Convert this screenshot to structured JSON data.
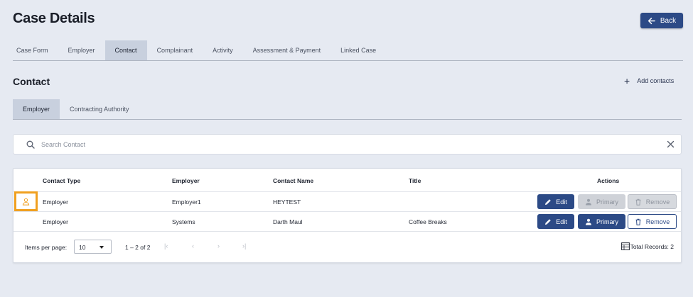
{
  "header": {
    "title": "Case Details",
    "back_label": "Back"
  },
  "main_tabs": [
    {
      "label": "Case Form",
      "active": false
    },
    {
      "label": "Employer",
      "active": false
    },
    {
      "label": "Contact",
      "active": true
    },
    {
      "label": "Complainant",
      "active": false
    },
    {
      "label": "Activity",
      "active": false
    },
    {
      "label": "Assessment & Payment",
      "active": false
    },
    {
      "label": "Linked Case",
      "active": false
    }
  ],
  "contact_section": {
    "title": "Contact",
    "add_label": "Add contacts",
    "sub_tabs": [
      {
        "label": "Employer",
        "active": true
      },
      {
        "label": "Contracting Authority",
        "active": false
      }
    ]
  },
  "search": {
    "placeholder": "Search Contact",
    "value": ""
  },
  "table": {
    "columns": [
      "Contact Type",
      "Employer",
      "Contact Name",
      "Title",
      "Actions"
    ],
    "rows": [
      {
        "contact_type": "Employer",
        "employer": "Employer1",
        "contact_name": "HEYTEST",
        "title": "",
        "is_primary": true
      },
      {
        "contact_type": "Employer",
        "employer": "Systems",
        "contact_name": "Darth Maul",
        "title": "Coffee Breaks",
        "is_primary": false
      }
    ],
    "actions": {
      "edit_label": "Edit",
      "primary_label": "Primary",
      "remove_label": "Remove"
    }
  },
  "paginator": {
    "items_per_page_label": "Items per page:",
    "items_per_page_value": "10",
    "range_label": "1 – 2 of 2",
    "total_records_label": "Total Records: 2"
  },
  "colors": {
    "accent": "#2c4a86",
    "primary_marker": "#f0a020",
    "page_background": "#e6eaf2"
  }
}
